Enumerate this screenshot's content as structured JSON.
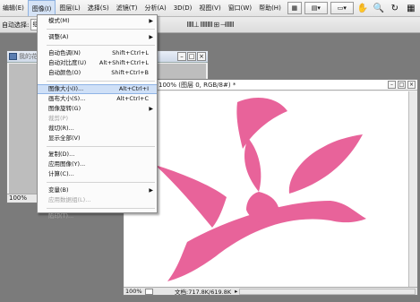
{
  "menubar": {
    "items": [
      "编辑(E)",
      "图像(I)",
      "图层(L)",
      "选择(S)",
      "滤镜(T)",
      "分析(A)",
      "3D(D)",
      "视图(V)",
      "窗口(W)",
      "帮助(H)"
    ],
    "active_index": 1,
    "zoom_icon": "view-extras-icon",
    "arrange_icon": "arrange-icon",
    "hand_icon": "hand-icon",
    "zoom_tool_icon": "zoom-icon",
    "rotate_icon": "rotate-view-icon",
    "grid_icon": "grid-icon"
  },
  "options_bar": {
    "auto_select_label": "自动选择:",
    "auto_select_value": "组",
    "align_glyphs": "ⅡⅢ⊥ ⅢⅢⅢ ⊞ ⊣ⅢⅢ"
  },
  "doc_small": {
    "title": "我的花",
    "zoom": "100%"
  },
  "doc_main": {
    "title": "100% (图层 0, RGB/8#) *",
    "zoom": "100%",
    "doc_info": "文档:717.8K/619.8K",
    "shape_color": "#e8639a"
  },
  "image_menu": {
    "items": [
      {
        "label": "模式(M)",
        "shortcut": "",
        "submenu": true,
        "disabled": false,
        "highlighted": false
      },
      {
        "sep": true
      },
      {
        "label": "调整(A)",
        "shortcut": "",
        "submenu": true,
        "disabled": false,
        "highlighted": false
      },
      {
        "sep": true
      },
      {
        "label": "自动色调(N)",
        "shortcut": "Shift+Ctrl+L",
        "submenu": false,
        "disabled": false,
        "highlighted": false
      },
      {
        "label": "自动对比度(U)",
        "shortcut": "Alt+Shift+Ctrl+L",
        "submenu": false,
        "disabled": false,
        "highlighted": false
      },
      {
        "label": "自动颜色(O)",
        "shortcut": "Shift+Ctrl+B",
        "submenu": false,
        "disabled": false,
        "highlighted": false
      },
      {
        "sep": true
      },
      {
        "label": "图像大小(I)...",
        "shortcut": "Alt+Ctrl+I",
        "submenu": false,
        "disabled": false,
        "highlighted": true
      },
      {
        "label": "画布大小(S)...",
        "shortcut": "Alt+Ctrl+C",
        "submenu": false,
        "disabled": false,
        "highlighted": false
      },
      {
        "label": "图像旋转(G)",
        "shortcut": "",
        "submenu": true,
        "disabled": false,
        "highlighted": false
      },
      {
        "label": "裁剪(P)",
        "shortcut": "",
        "submenu": false,
        "disabled": true,
        "highlighted": false
      },
      {
        "label": "裁切(R)...",
        "shortcut": "",
        "submenu": false,
        "disabled": false,
        "highlighted": false
      },
      {
        "label": "显示全部(V)",
        "shortcut": "",
        "submenu": false,
        "disabled": false,
        "highlighted": false
      },
      {
        "sep": true
      },
      {
        "label": "复制(D)...",
        "shortcut": "",
        "submenu": false,
        "disabled": false,
        "highlighted": false
      },
      {
        "label": "应用图像(Y)...",
        "shortcut": "",
        "submenu": false,
        "disabled": false,
        "highlighted": false
      },
      {
        "label": "计算(C)...",
        "shortcut": "",
        "submenu": false,
        "disabled": false,
        "highlighted": false
      },
      {
        "sep": true
      },
      {
        "label": "变量(B)",
        "shortcut": "",
        "submenu": true,
        "disabled": false,
        "highlighted": false
      },
      {
        "label": "应用数据组(L)...",
        "shortcut": "",
        "submenu": false,
        "disabled": true,
        "highlighted": false
      },
      {
        "sep": true
      },
      {
        "label": "陷印(T)...",
        "shortcut": "",
        "submenu": false,
        "disabled": true,
        "highlighted": false
      }
    ]
  }
}
